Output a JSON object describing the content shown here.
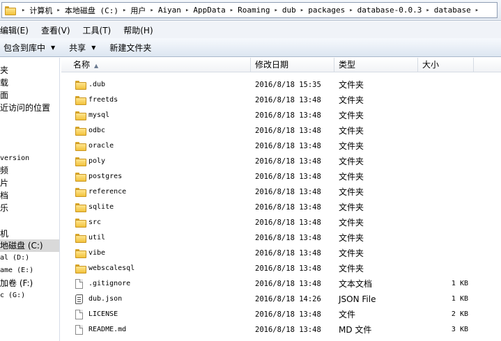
{
  "address_bar": {
    "crumbs": [
      "计算机",
      "本地磁盘 (C:)",
      "用户",
      "Aiyan",
      "AppData",
      "Roaming",
      "dub",
      "packages",
      "database-0.0.3",
      "database"
    ]
  },
  "menu": {
    "items": [
      "编辑(E)",
      "查看(V)",
      "工具(T)",
      "帮助(H)"
    ]
  },
  "toolbar": {
    "include_label": "包含到库中",
    "share_label": "共享",
    "new_folder_label": "新建文件夹",
    "dropdown_glyph": "▼"
  },
  "nav": {
    "items": [
      "夹",
      "载",
      "面",
      "近访问的位置",
      "version",
      "频",
      "片",
      "档",
      "乐",
      "机",
      "地磁盘 (C:)",
      "al (D:)",
      "ame (E:)",
      "加卷 (F:)",
      "c (G:)"
    ]
  },
  "columns": {
    "name": "名称",
    "date": "修改日期",
    "type": "类型",
    "size": "大小",
    "sort_glyph": "▲"
  },
  "files": [
    {
      "name": ".dub",
      "date": "2016/8/18 15:35",
      "type": "文件夹",
      "size": "",
      "icon": "folder-icon"
    },
    {
      "name": "freetds",
      "date": "2016/8/18 13:48",
      "type": "文件夹",
      "size": "",
      "icon": "folder-icon"
    },
    {
      "name": "mysql",
      "date": "2016/8/18 13:48",
      "type": "文件夹",
      "size": "",
      "icon": "folder-icon"
    },
    {
      "name": "odbc",
      "date": "2016/8/18 13:48",
      "type": "文件夹",
      "size": "",
      "icon": "folder-icon"
    },
    {
      "name": "oracle",
      "date": "2016/8/18 13:48",
      "type": "文件夹",
      "size": "",
      "icon": "folder-icon"
    },
    {
      "name": "poly",
      "date": "2016/8/18 13:48",
      "type": "文件夹",
      "size": "",
      "icon": "folder-icon"
    },
    {
      "name": "postgres",
      "date": "2016/8/18 13:48",
      "type": "文件夹",
      "size": "",
      "icon": "folder-icon"
    },
    {
      "name": "reference",
      "date": "2016/8/18 13:48",
      "type": "文件夹",
      "size": "",
      "icon": "folder-icon"
    },
    {
      "name": "sqlite",
      "date": "2016/8/18 13:48",
      "type": "文件夹",
      "size": "",
      "icon": "folder-icon"
    },
    {
      "name": "src",
      "date": "2016/8/18 13:48",
      "type": "文件夹",
      "size": "",
      "icon": "folder-icon"
    },
    {
      "name": "util",
      "date": "2016/8/18 13:48",
      "type": "文件夹",
      "size": "",
      "icon": "folder-icon"
    },
    {
      "name": "vibe",
      "date": "2016/8/18 13:48",
      "type": "文件夹",
      "size": "",
      "icon": "folder-icon"
    },
    {
      "name": "webscalesql",
      "date": "2016/8/18 13:48",
      "type": "文件夹",
      "size": "",
      "icon": "folder-icon"
    },
    {
      "name": ".gitignore",
      "date": "2016/8/18 13:48",
      "type": "文本文档",
      "size": "1 KB",
      "icon": "text-file-icon"
    },
    {
      "name": "dub.json",
      "date": "2016/8/18 14:26",
      "type": "JSON File",
      "size": "1 KB",
      "icon": "json-file-icon"
    },
    {
      "name": "LICENSE",
      "date": "2016/8/18 13:48",
      "type": "文件",
      "size": "2 KB",
      "icon": "file-icon"
    },
    {
      "name": "README.md",
      "date": "2016/8/18 13:48",
      "type": "MD 文件",
      "size": "3 KB",
      "icon": "file-icon"
    }
  ]
}
